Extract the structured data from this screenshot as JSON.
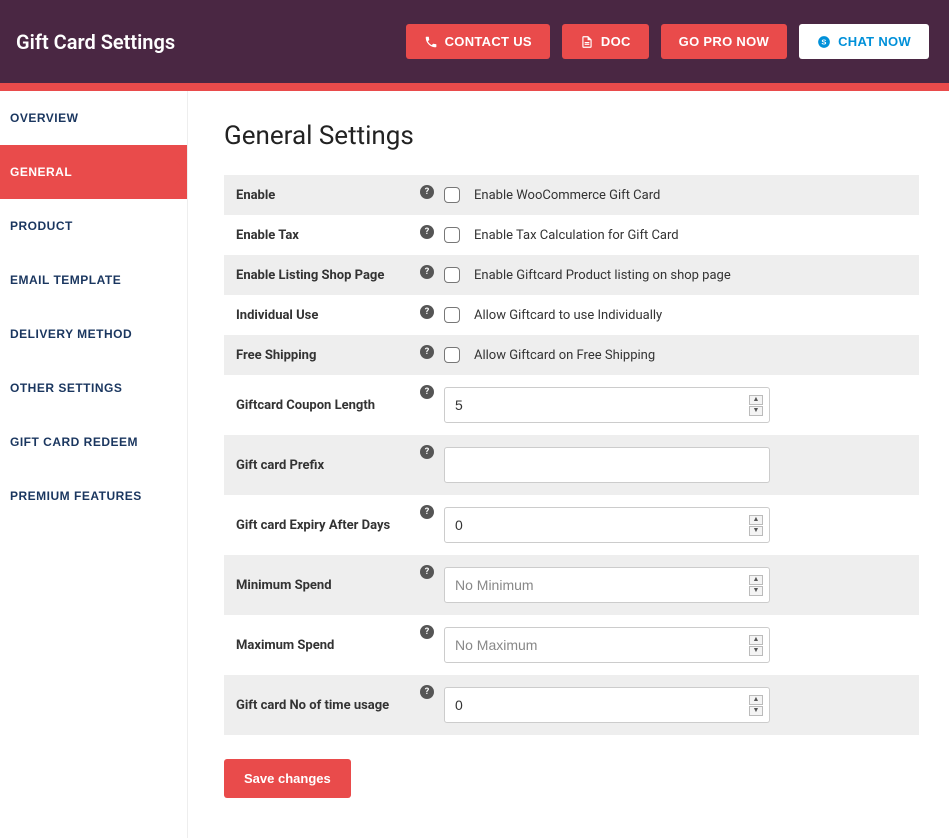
{
  "header": {
    "title": "Gift Card Settings",
    "buttons": {
      "contact": "CONTACT US",
      "doc": "DOC",
      "gopro": "GO PRO NOW",
      "chat": "CHAT NOW"
    }
  },
  "sidebar": {
    "items": [
      {
        "label": "OVERVIEW",
        "active": false
      },
      {
        "label": "GENERAL",
        "active": true
      },
      {
        "label": "PRODUCT",
        "active": false
      },
      {
        "label": "EMAIL TEMPLATE",
        "active": false
      },
      {
        "label": "DELIVERY METHOD",
        "active": false
      },
      {
        "label": "OTHER SETTINGS",
        "active": false
      },
      {
        "label": "GIFT CARD REDEEM",
        "active": false
      },
      {
        "label": "PREMIUM FEATURES",
        "active": false
      }
    ]
  },
  "main": {
    "title": "General Settings",
    "rows": {
      "enable": {
        "label": "Enable",
        "desc": "Enable WooCommerce Gift Card"
      },
      "enable_tax": {
        "label": "Enable Tax",
        "desc": "Enable Tax Calculation for Gift Card"
      },
      "enable_listing": {
        "label": "Enable Listing Shop Page",
        "desc": "Enable Giftcard Product listing on shop page"
      },
      "individual_use": {
        "label": "Individual Use",
        "desc": "Allow Giftcard to use Individually"
      },
      "free_shipping": {
        "label": "Free Shipping",
        "desc": "Allow Giftcard on Free Shipping"
      },
      "coupon_length": {
        "label": "Giftcard Coupon Length",
        "value": "5"
      },
      "prefix": {
        "label": "Gift card Prefix",
        "value": ""
      },
      "expiry_days": {
        "label": "Gift card Expiry After Days",
        "value": "0"
      },
      "min_spend": {
        "label": "Minimum Spend",
        "placeholder": "No Minimum",
        "value": ""
      },
      "max_spend": {
        "label": "Maximum Spend",
        "placeholder": "No Maximum",
        "value": ""
      },
      "usage_count": {
        "label": "Gift card No of time usage",
        "value": "0"
      }
    },
    "save_label": "Save changes"
  }
}
